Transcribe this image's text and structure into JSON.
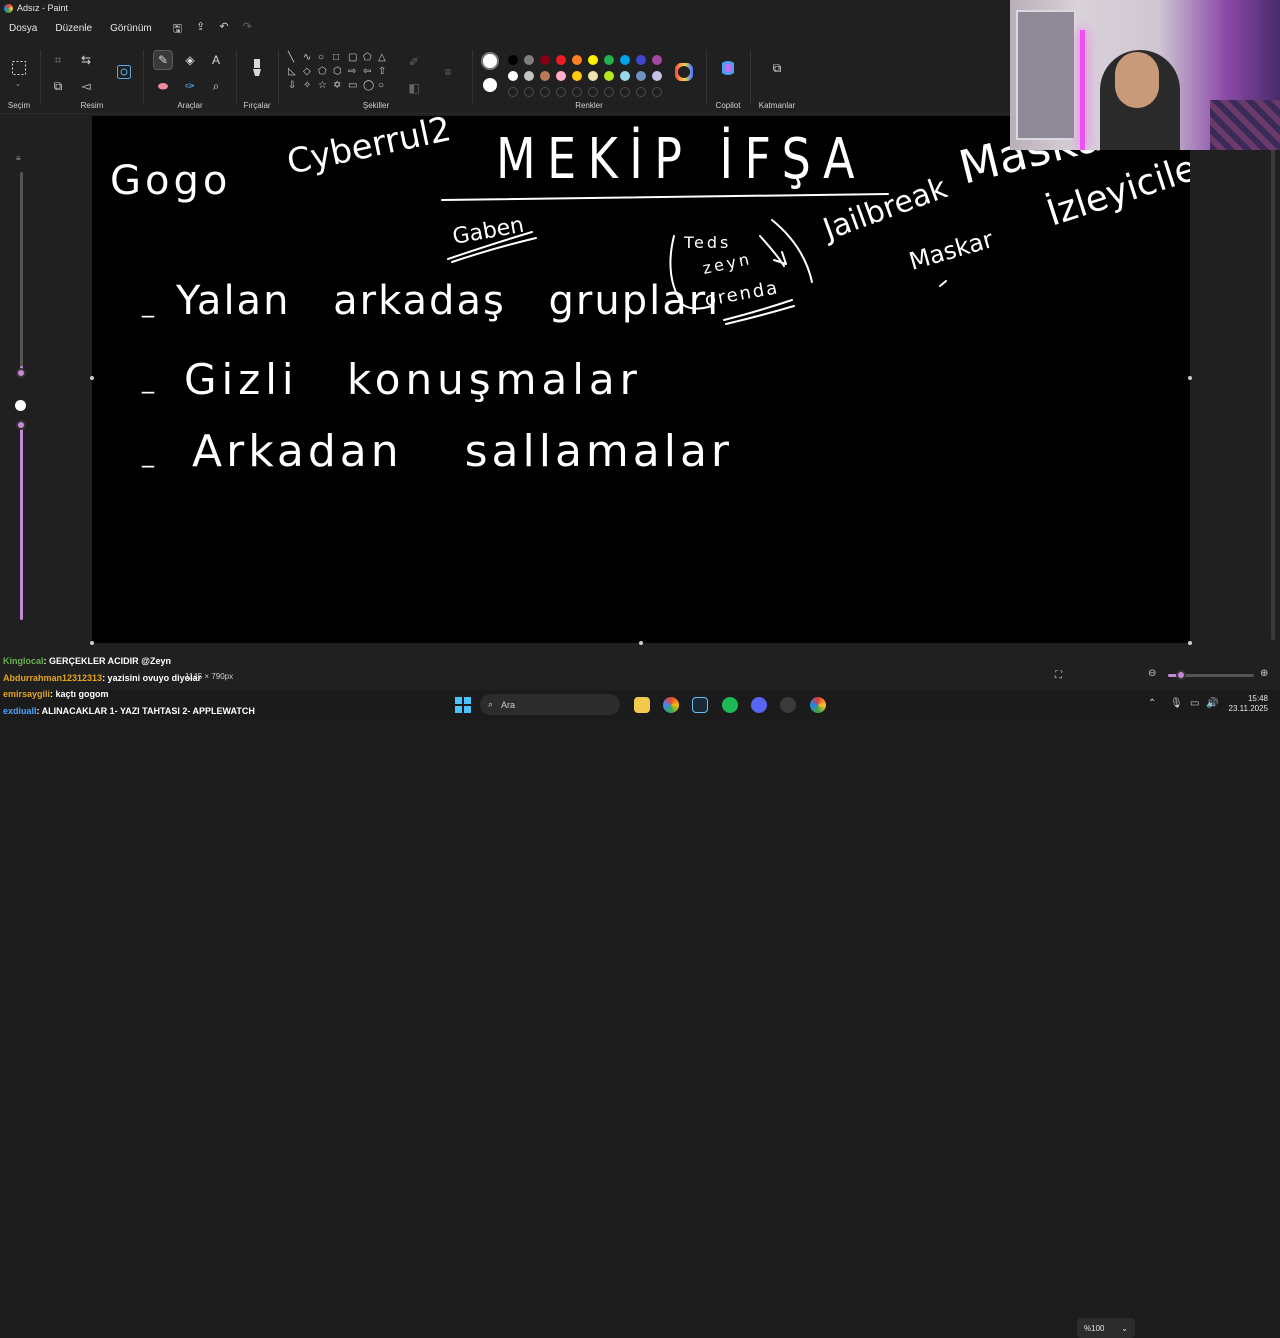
{
  "window": {
    "title": "Adsız - Paint"
  },
  "menu": {
    "items": [
      "Dosya",
      "Düzenle",
      "Görünüm"
    ]
  },
  "ribbon": {
    "groups": {
      "selection": "Seçim",
      "image": "Resim",
      "tools": "Araçlar",
      "brushes": "Fırçalar",
      "shapes": "Şekiller",
      "colors": "Renkler",
      "copilot": "Copilot",
      "layers": "Katmanlar"
    },
    "palette_row1": [
      "#000000",
      "#7f7f7f",
      "#880015",
      "#ed1c24",
      "#ff7f27",
      "#fff200",
      "#22b14c",
      "#00a2e8",
      "#3f48cc",
      "#a349a4"
    ],
    "palette_row2": [
      "#ffffff",
      "#c3c3c3",
      "#b97a57",
      "#ffaec9",
      "#ffc90e",
      "#efe4b0",
      "#b5e61d",
      "#99d9ea",
      "#7092be",
      "#c8bfe7"
    ],
    "primary_color": "#ffffff",
    "secondary_color": "#ffffff"
  },
  "canvas": {
    "background": "#000000",
    "ink": "#ffffff",
    "texts": {
      "title": "MEKİP İFŞA",
      "gogo": "Gogo",
      "cyber": "Cyberrul2",
      "gaben": "Gaben",
      "teds": "Teds",
      "zeyn": "zeyn",
      "orenda": "orenda",
      "jailbreak": "Jailbreak",
      "maskar_top": "Maskar",
      "maskar_small": "Maskar",
      "izleyiciler": "İzleyiciler",
      "line1": "Yalan arkadaş grupları",
      "line2": "Gizli konuşmalar",
      "line3": "Arkadan sallamalar",
      "dash": "_"
    }
  },
  "status": {
    "dimensions": "1145 × 790px",
    "zoom": "%100"
  },
  "chat": [
    {
      "user": "Kinglocal",
      "text": ": GERÇEKLER ACIDIR @Zeyn"
    },
    {
      "user": "Abdurrahman12312313",
      "text": ": yazisini ovuyo diyolar"
    },
    {
      "user": "emirsaygili",
      "text": ": kaçtı gogom"
    },
    {
      "user": "exdiuall",
      "text": ": ALINACAKLAR 1- YAZI TAHTASI 2- APPLEWATCH"
    }
  ],
  "taskbar": {
    "search_placeholder": "Ara",
    "time": "15:48",
    "date": "23.11.2025"
  }
}
